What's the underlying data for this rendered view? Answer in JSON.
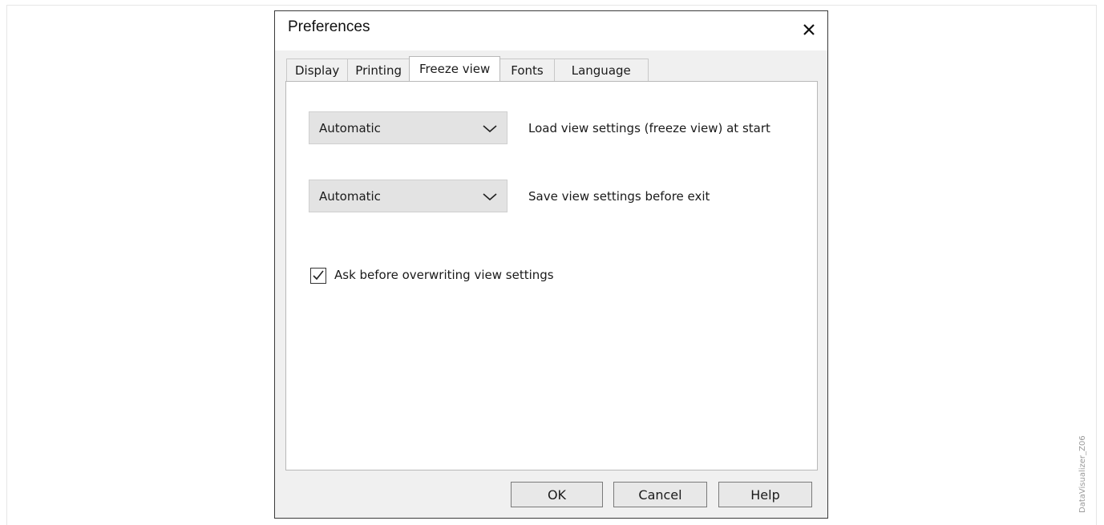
{
  "dialog": {
    "title": "Preferences",
    "close_icon": "close-icon"
  },
  "tabs": [
    {
      "label": "Display",
      "active": false
    },
    {
      "label": "Printing",
      "active": false
    },
    {
      "label": "Freeze view",
      "active": true
    },
    {
      "label": "Fonts",
      "active": false
    },
    {
      "label": "Language",
      "active": false
    }
  ],
  "freeze_view": {
    "load_setting": {
      "value": "Automatic",
      "label": "Load view settings (freeze view) at start"
    },
    "save_setting": {
      "value": "Automatic",
      "label": "Save view settings before exit"
    },
    "ask_overwrite": {
      "checked": true,
      "label": "Ask before overwriting view settings"
    }
  },
  "buttons": {
    "ok": "OK",
    "cancel": "Cancel",
    "help": "Help"
  },
  "side_label": "DataVisualizer_Z06"
}
